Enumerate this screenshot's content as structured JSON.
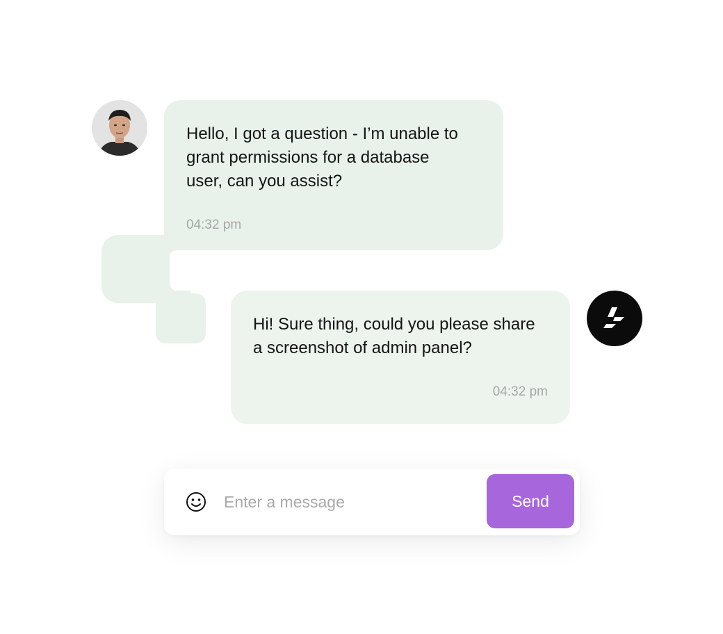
{
  "conversation": {
    "messages": [
      {
        "sender": "user",
        "text": "Hello, I got a question - I’m  unable to\ngrant permissions for a database\nuser, can you assist?",
        "time": "04:32 pm"
      },
      {
        "sender": "agent",
        "text": "Hi! Sure thing, could you please share\na screenshot of admin panel?",
        "time": "04:32 pm"
      }
    ]
  },
  "composer": {
    "placeholder": "Enter a message",
    "value": "",
    "send_label": "Send",
    "emoji_icon": "smiley-face-icon"
  },
  "colors": {
    "user_bubble": "#e9f2ea",
    "agent_bubble": "#edf4ee",
    "send_button": "#a766dc",
    "timestamp": "#a6a6a6"
  },
  "icons": {
    "user_avatar": "user-avatar-photo",
    "agent_avatar": "agent-logo-avatar"
  }
}
